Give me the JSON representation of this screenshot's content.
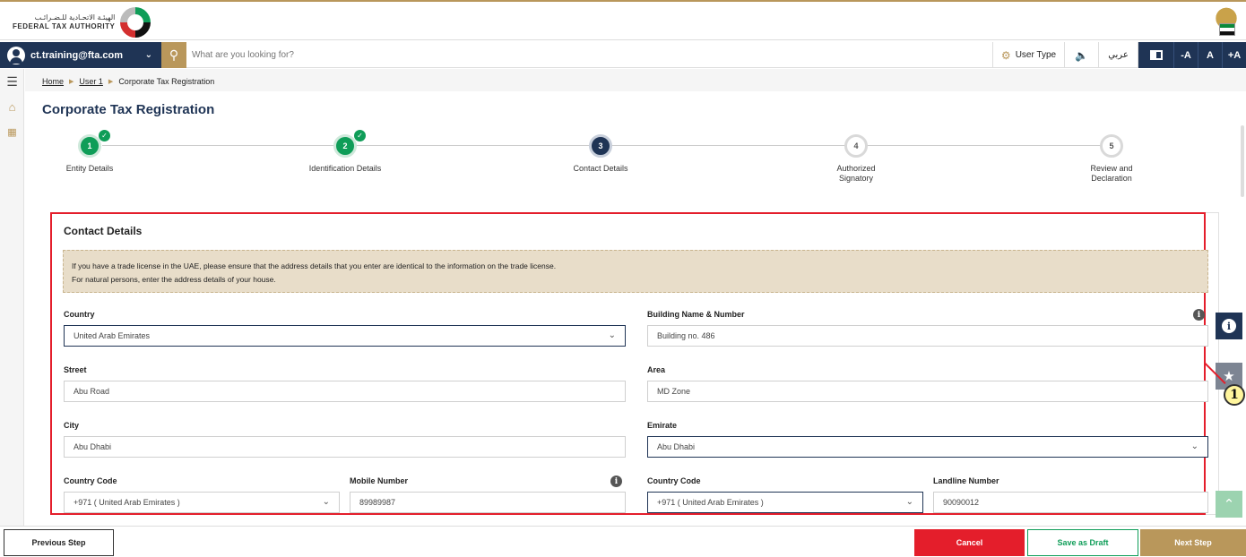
{
  "header": {
    "logo_arabic": "الهيئـة الاتحـادية للـضـرائـب",
    "logo_english": "FEDERAL TAX AUTHORITY"
  },
  "navbar": {
    "account_email": "ct.training@fta.com",
    "search_placeholder": "What are you looking for?",
    "user_type_label": "User Type",
    "language_label": "عربي",
    "font_decrease": "-A",
    "font_normal": "A",
    "font_increase": "+A"
  },
  "breadcrumb": {
    "home": "Home",
    "user": "User 1",
    "current": "Corporate Tax Registration"
  },
  "page": {
    "title": "Corporate Tax Registration"
  },
  "steps": [
    {
      "number": "1",
      "label": "Entity Details",
      "status": "done"
    },
    {
      "number": "2",
      "label": "Identification Details",
      "status": "done"
    },
    {
      "number": "3",
      "label": "Contact Details",
      "status": "active"
    },
    {
      "number": "4",
      "label": "Authorized Signatory",
      "status": "todo"
    },
    {
      "number": "5",
      "label": "Review and Declaration",
      "status": "todo"
    }
  ],
  "contact": {
    "title": "Contact Details",
    "notice_line1": "If you have a trade license in the UAE, please ensure that the address details that you enter are identical to the information on the trade license.",
    "notice_line2": "For natural persons, enter the address details of your house.",
    "country_label": "Country",
    "country_value": "United Arab Emirates",
    "building_label": "Building Name & Number",
    "building_value": "Building no. 486",
    "street_label": "Street",
    "street_value": "Abu Road",
    "area_label": "Area",
    "area_value": "MD Zone",
    "city_label": "City",
    "city_value": "Abu Dhabi",
    "emirate_label": "Emirate",
    "emirate_value": "Abu Dhabi",
    "mobile_code_label": "Country Code",
    "mobile_code_value": "+971 ( United Arab Emirates )",
    "mobile_label": "Mobile Number",
    "mobile_value": "89989987",
    "landline_code_label": "Country Code",
    "landline_code_value": "+971 ( United Arab Emirates )",
    "landline_label": "Landline Number",
    "landline_value": "90090012"
  },
  "annotation": {
    "callout_number": "1"
  },
  "footer": {
    "previous": "Previous Step",
    "cancel": "Cancel",
    "save_draft": "Save as Draft",
    "next": "Next Step"
  },
  "colors": {
    "navy": "#1f3455",
    "gold": "#b9975b",
    "green": "#0f9d58",
    "red": "#e41e2b"
  }
}
